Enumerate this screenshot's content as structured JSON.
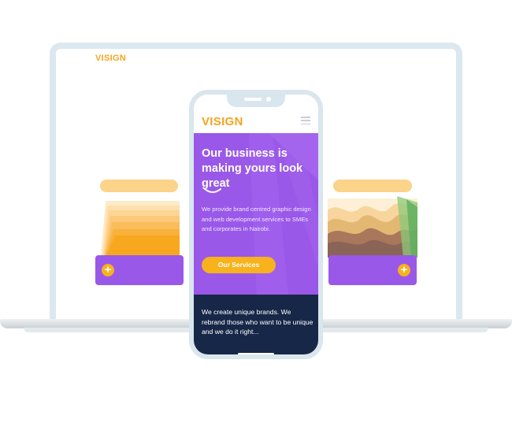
{
  "laptop": {
    "logo": "VISIGN"
  },
  "phone": {
    "brand": "VISIGN",
    "hero": {
      "title": "Our business is making yours look great",
      "description": "We provide brand centred graphic design and web development services to SMEs and corporates in Nairobi.",
      "cta_label": "Our Services"
    },
    "secondary_text": "We create unique brands. We rebrand those who want to be unique and we do it right..."
  },
  "cards": {
    "plus_glyph": "+"
  },
  "colors": {
    "brand_orange": "#f4a41c",
    "purple": "#9a58e8",
    "navy": "#172747",
    "device_frame": "#dbe8ef"
  },
  "icons": [
    "menu-icon",
    "plus-icon",
    "smile-underline-icon"
  ]
}
